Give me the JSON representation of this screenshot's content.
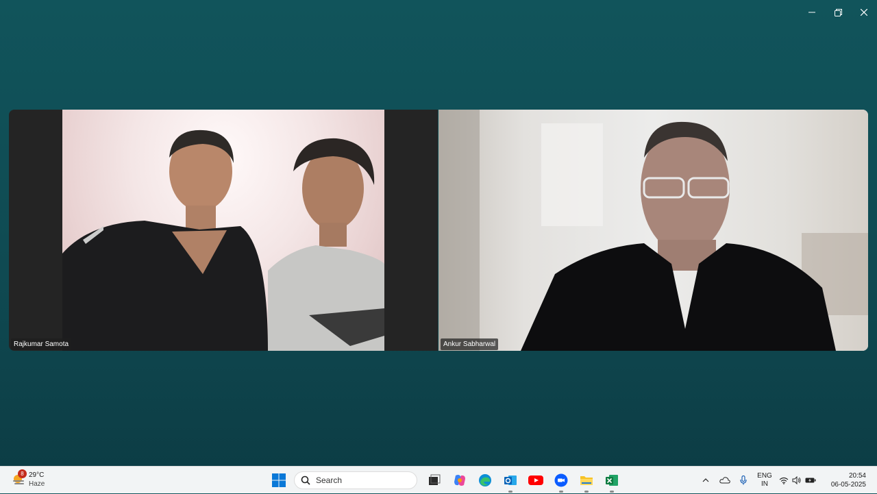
{
  "window": {
    "minimize_icon": "minimize-icon",
    "restore_icon": "restore-icon",
    "close_icon": "close-icon"
  },
  "participants": [
    {
      "name": "Rajkumar Samota"
    },
    {
      "name": "Ankur Sabharwal"
    }
  ],
  "taskbar": {
    "weather": {
      "badge": "8",
      "temperature": "29°C",
      "condition": "Haze"
    },
    "search": {
      "label": "Search"
    },
    "apps": [
      "start-icon",
      "task-view-icon",
      "copilot-icon",
      "edge-icon",
      "outlook-icon",
      "youtube-icon",
      "zoom-icon",
      "file-explorer-icon",
      "excel-icon"
    ],
    "tray": {
      "language": "ENG",
      "region": "IN",
      "time": "20:54",
      "date": "06-05-2025"
    }
  }
}
